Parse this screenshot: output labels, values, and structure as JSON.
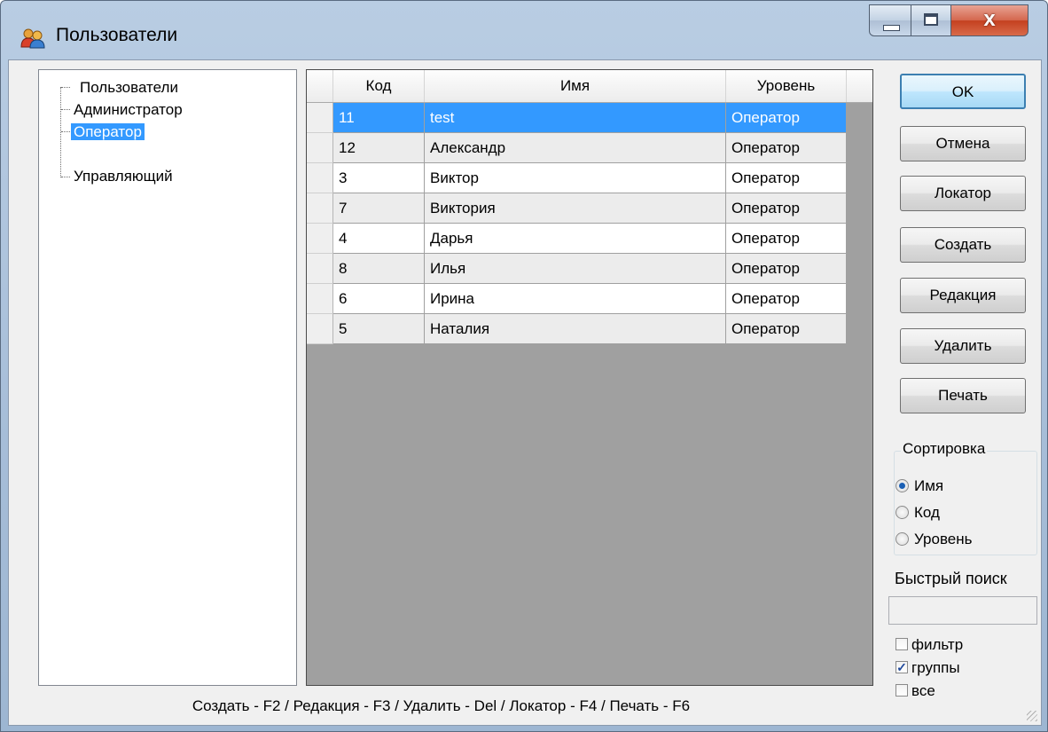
{
  "window": {
    "title": "Пользователи",
    "icon": "users-icon",
    "close_glyph": "x"
  },
  "tree": {
    "items": [
      {
        "label": "Пользователи",
        "selected": false
      },
      {
        "label": "Администратор",
        "selected": false
      },
      {
        "label": "Оператор",
        "selected": true
      },
      {
        "label": "Управляющий",
        "selected": false
      }
    ]
  },
  "grid": {
    "columns": [
      "Код",
      "Имя",
      "Уровень"
    ],
    "rows": [
      {
        "code": "11",
        "name": "test",
        "level": "Оператор",
        "selected": true
      },
      {
        "code": "12",
        "name": "Александр",
        "level": "Оператор"
      },
      {
        "code": "3",
        "name": "Виктор",
        "level": "Оператор"
      },
      {
        "code": "7",
        "name": "Виктория",
        "level": "Оператор"
      },
      {
        "code": "4",
        "name": "Дарья",
        "level": "Оператор"
      },
      {
        "code": "8",
        "name": "Илья",
        "level": "Оператор"
      },
      {
        "code": "6",
        "name": "Ирина",
        "level": "Оператор"
      },
      {
        "code": "5",
        "name": "Наталия",
        "level": "Оператор"
      }
    ]
  },
  "buttons": {
    "ok": "OK",
    "cancel": "Отмена",
    "locator": "Локатор",
    "create": "Создать",
    "edit": "Редакция",
    "delete": "Удалить",
    "print": "Печать"
  },
  "sort": {
    "title": "Сортировка",
    "options": [
      "Имя",
      "Код",
      "Уровень"
    ],
    "selected": "Имя"
  },
  "search": {
    "label": "Быстрый поиск",
    "value": ""
  },
  "options": {
    "filter": {
      "label": "фильтр",
      "checked": false
    },
    "groups": {
      "label": "группы",
      "checked": true
    },
    "all": {
      "label": "все",
      "checked": false
    }
  },
  "status": {
    "hotkeys": "Создать - F2 / Редакция - F3 / Удалить - Del / Локатор - F4 / Печать - F6"
  },
  "colors": {
    "selection": "#3399ff",
    "grid_background": "#a0a0a0",
    "close_button": "#c4401f"
  }
}
